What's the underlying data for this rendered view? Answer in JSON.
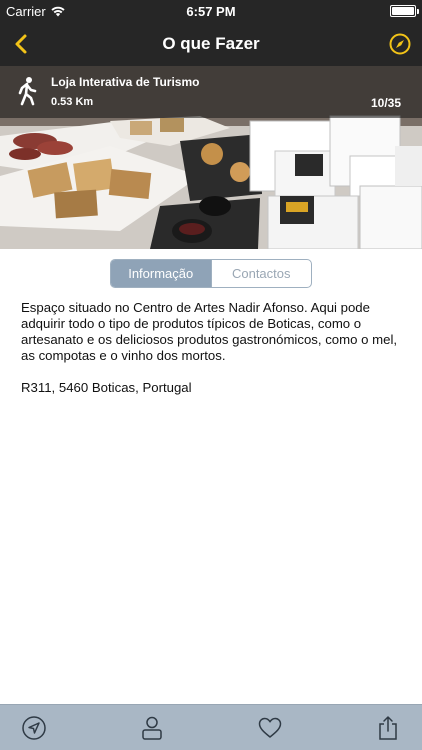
{
  "status_bar": {
    "carrier": "Carrier",
    "time": "6:57 PM"
  },
  "nav": {
    "title": "O que Fazer",
    "accent_color": "#f2c318"
  },
  "place": {
    "name": "Loja Interativa de Turismo",
    "distance": "0.53 Km",
    "counter": "10/35"
  },
  "segments": [
    {
      "label": "Informação",
      "active": true
    },
    {
      "label": "Contactos",
      "active": false
    }
  ],
  "content": {
    "description": "Espaço situado no Centro de Artes Nadir Afonso. Aqui pode adquirir todo o tipo de produtos típicos de Boticas, como o artesanato e os deliciosos produtos gastronómicos, como o mel, as compotas e o vinho dos mortos.",
    "address": "R311, 5460 Boticas, Portugal"
  },
  "tab_bar": {
    "icons": [
      "location-arrow-icon",
      "person-icon",
      "heart-icon",
      "share-icon"
    ]
  }
}
